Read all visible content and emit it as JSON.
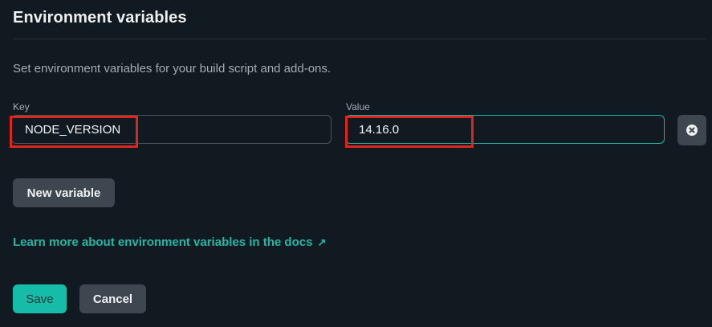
{
  "section": {
    "title": "Environment variables",
    "description": "Set environment variables for your build script and add-ons."
  },
  "variable": {
    "key_label": "Key",
    "key_value": "NODE_VERSION",
    "value_label": "Value",
    "value_value": "14.16.0",
    "clear_icon": "circle-x-icon"
  },
  "actions": {
    "new_variable": "New variable",
    "docs_link": "Learn more about environment variables in the docs",
    "docs_link_icon": "↗",
    "save": "Save",
    "cancel": "Cancel"
  },
  "colors": {
    "background": "#111a21",
    "accent": "#17bca8",
    "highlight": "#e0261c"
  }
}
